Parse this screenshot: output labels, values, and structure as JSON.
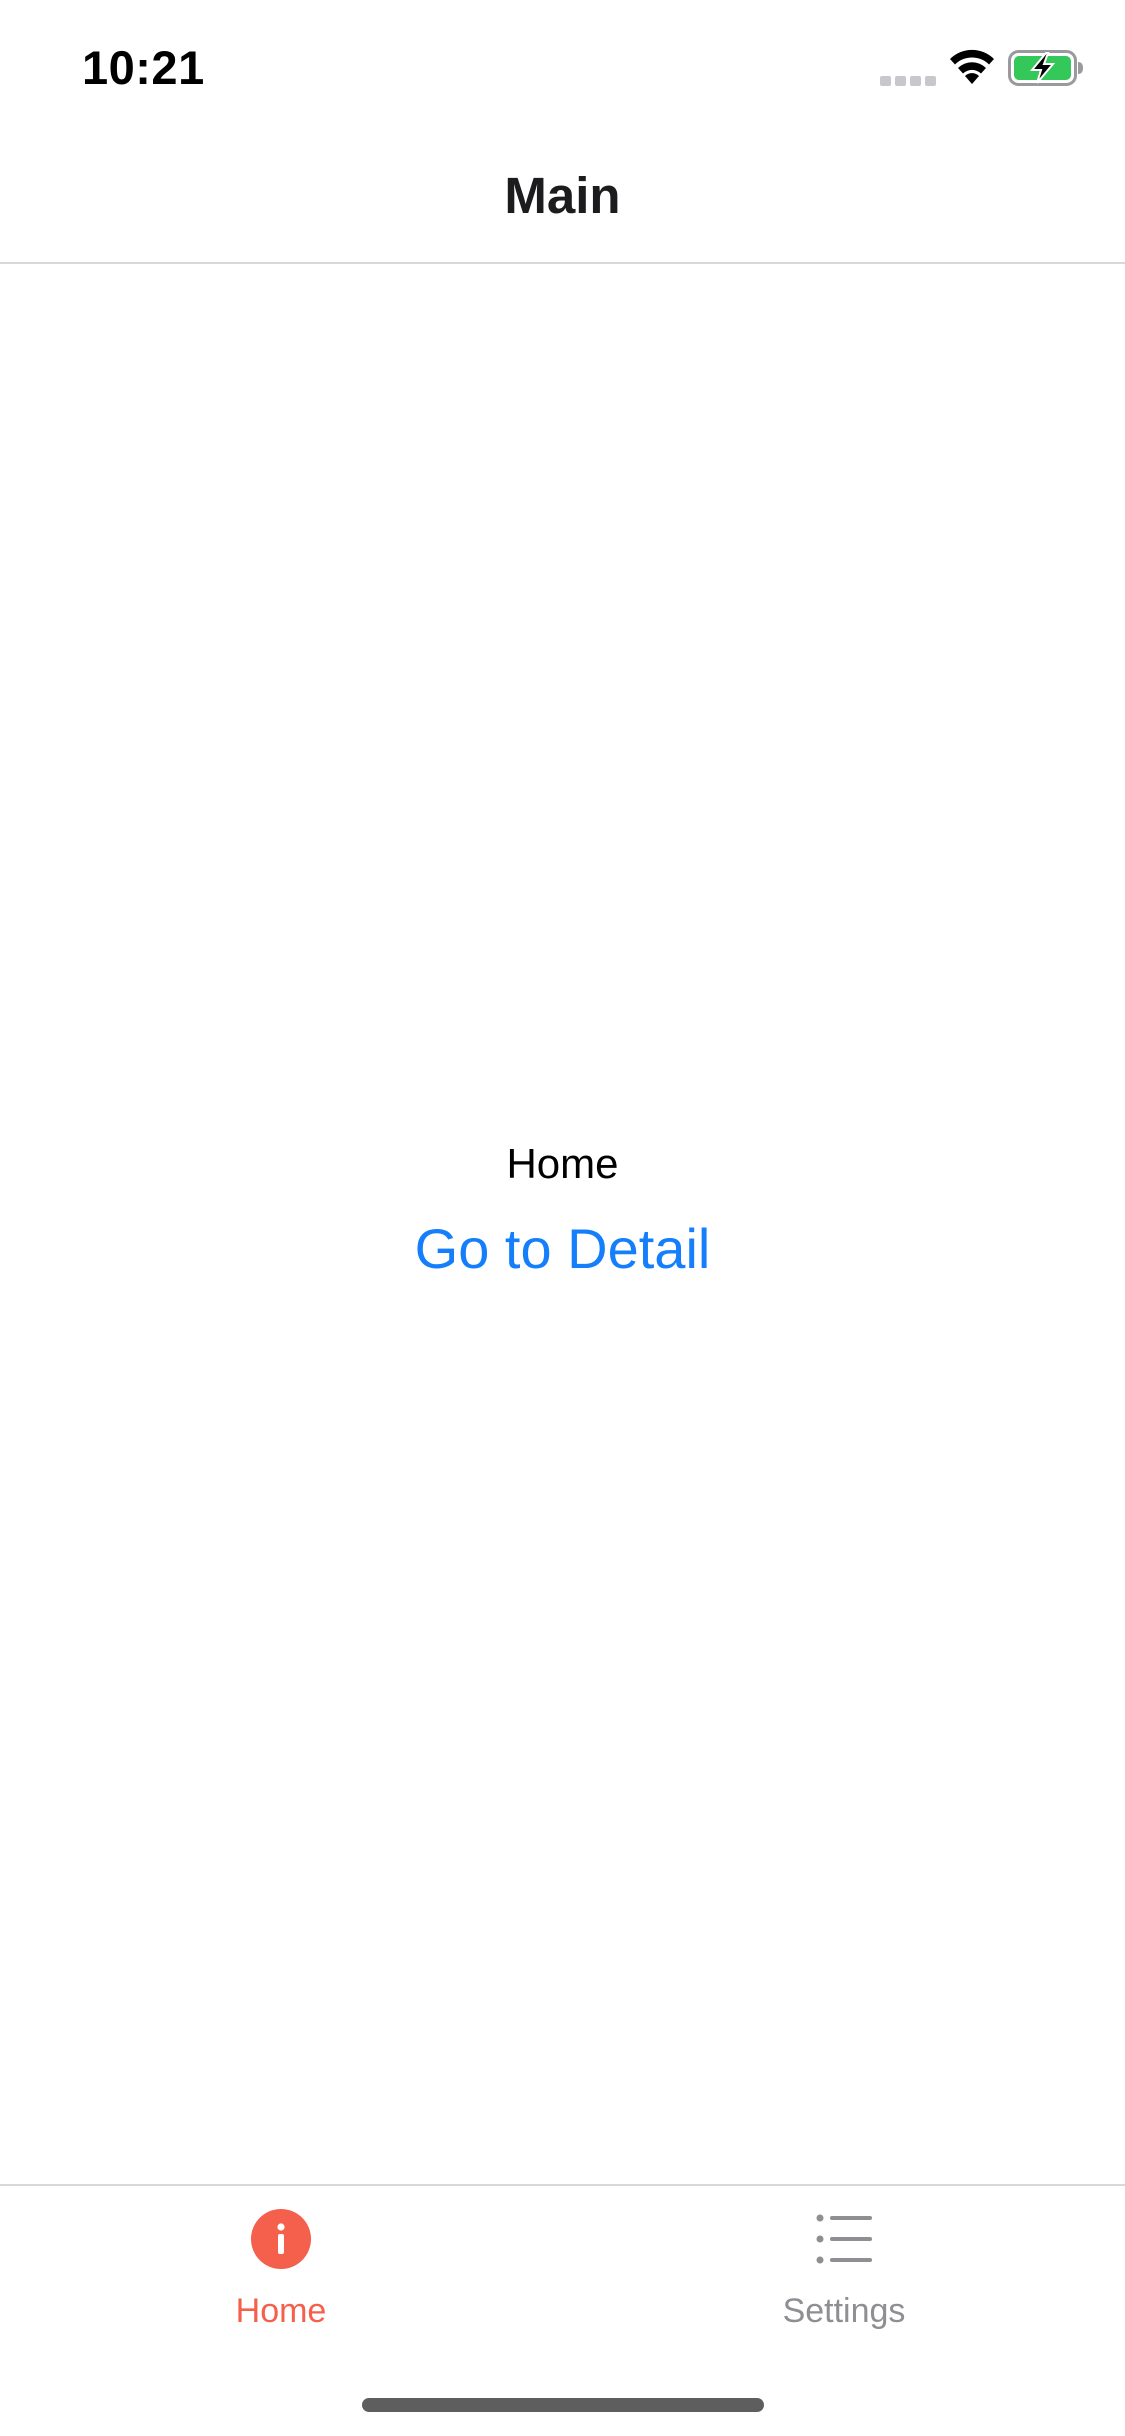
{
  "status_bar": {
    "time": "10:21",
    "icons": [
      "cellular-signal-icon",
      "wifi-icon",
      "battery-charging-icon"
    ],
    "battery_color": "#34c759"
  },
  "nav": {
    "title": "Main"
  },
  "content": {
    "label": "Home",
    "link_label": "Go to Detail",
    "link_color": "#147efb"
  },
  "tab_bar": {
    "active_color": "#f4604b",
    "inactive_color": "#8e8e93",
    "tabs": [
      {
        "label": "Home",
        "icon": "info-circle-icon",
        "active": true
      },
      {
        "label": "Settings",
        "icon": "list-icon",
        "active": false
      }
    ]
  }
}
